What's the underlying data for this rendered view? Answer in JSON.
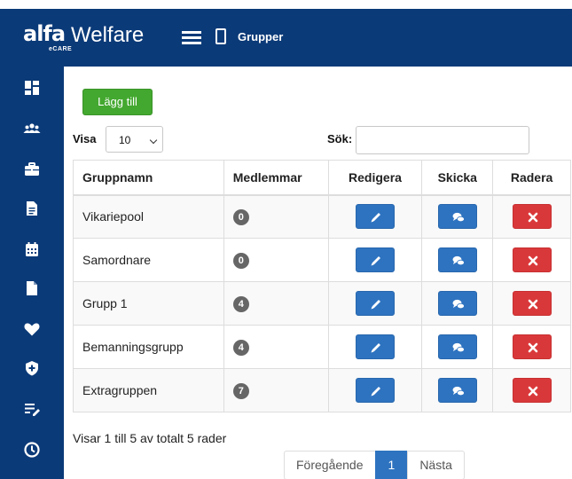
{
  "brand": {
    "logo_main": "alfa",
    "logo_product": "Welfare",
    "logo_sub": "eCARE"
  },
  "header": {
    "breadcrumb": "Grupper"
  },
  "toolbar": {
    "add_label": "Lägg till"
  },
  "filter": {
    "show_label": "Visa",
    "show_value": "10",
    "search_label": "Sök:",
    "search_value": ""
  },
  "table": {
    "headers": [
      "Gruppnamn",
      "Medlemmar",
      "Redigera",
      "Skicka",
      "Radera"
    ],
    "rows": [
      {
        "name": "Vikariepool",
        "members": "0"
      },
      {
        "name": "Samordnare",
        "members": "0"
      },
      {
        "name": "Grupp 1",
        "members": "4"
      },
      {
        "name": "Bemanningsgrupp",
        "members": "4"
      },
      {
        "name": "Extragruppen",
        "members": "7"
      }
    ]
  },
  "footer": {
    "info": "Visar 1 till 5 av totalt 5 rader"
  },
  "pagination": {
    "prev": "Föregående",
    "current": "1",
    "next": "Nästa"
  },
  "sidebar": {
    "icons": [
      "dashboard-icon",
      "users-icon",
      "briefcase-icon",
      "document-icon",
      "calendar-icon",
      "file-icon",
      "heart-icon",
      "shield-plus-icon",
      "list-edit-icon",
      "clock-icon"
    ]
  },
  "colors": {
    "nav": "#0b3a78",
    "add": "#43a82f",
    "primary": "#2e73c0",
    "danger": "#d9383a",
    "badge": "#666666"
  }
}
